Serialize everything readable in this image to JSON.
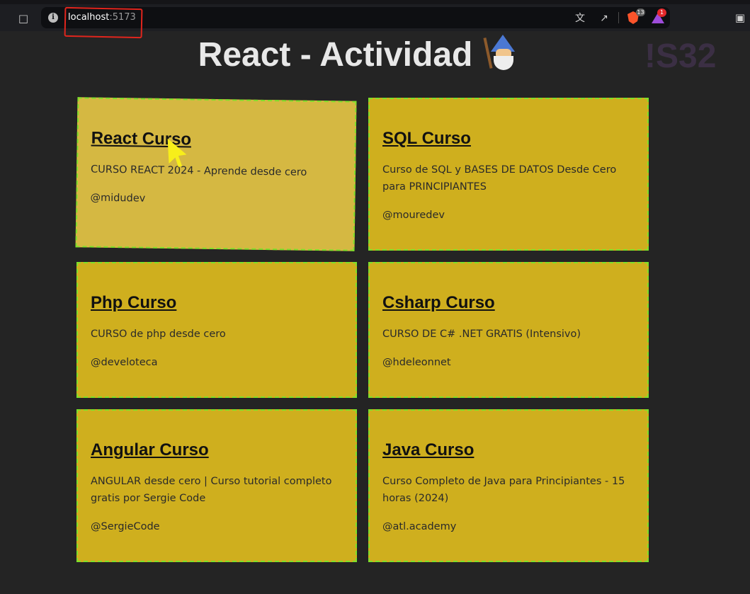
{
  "browser": {
    "url_host": "localhost",
    "url_port": ":5173",
    "brave_badge": "13",
    "rewards_badge": "1"
  },
  "page": {
    "title": "React - Actividad",
    "watermark": "!S32"
  },
  "cards": [
    {
      "title": "React Curso",
      "description": "CURSO REACT 2024 - Aprende desde cero",
      "author": "@midudev"
    },
    {
      "title": "SQL Curso",
      "description": "Curso de SQL y BASES DE DATOS Desde Cero para PRINCIPIANTES",
      "author": "@mouredev"
    },
    {
      "title": "Php Curso",
      "description": "CURSO de php desde cero",
      "author": "@develoteca"
    },
    {
      "title": "Csharp Curso",
      "description": "CURSO DE C# .NET GRATIS (Intensivo)",
      "author": "@hdeleonnet"
    },
    {
      "title": "Angular Curso",
      "description": "ANGULAR desde cero | Curso tutorial completo gratis por Sergie Code",
      "author": "@SergieCode"
    },
    {
      "title": "Java Curso",
      "description": "Curso Completo de Java para Principiantes - 15 horas (2024)",
      "author": "@atl.academy"
    }
  ],
  "colors": {
    "background": "#242424",
    "card": "#cfaf1e",
    "card_border": "#7ee02a",
    "highlight": "#e0251d",
    "cursor": "#f7ee1a"
  },
  "icons": [
    "bookmark-icon",
    "info-icon",
    "translate-icon",
    "share-icon",
    "brave-shields-icon",
    "brave-rewards-icon",
    "extensions-icon",
    "wizard-icon"
  ]
}
